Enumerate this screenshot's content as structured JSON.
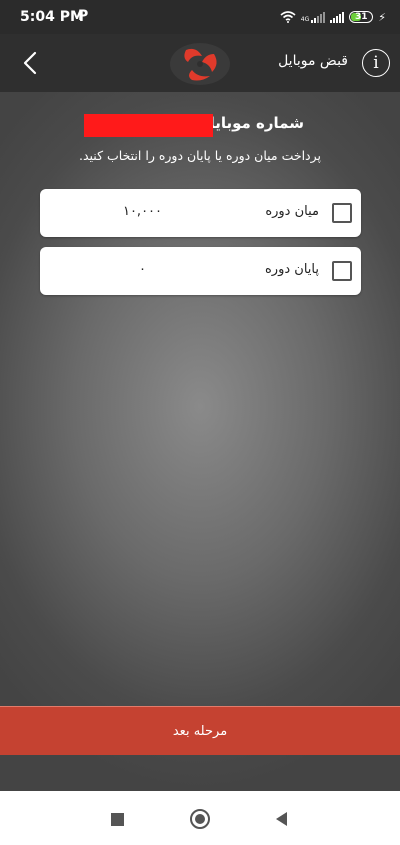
{
  "status_bar": {
    "time": "5:04 PM",
    "notification_glyph": "P",
    "network_label": "4G",
    "battery_level": "31",
    "icons": [
      "wifi-icon",
      "signal-icon",
      "signal-icon",
      "battery-icon",
      "charging-bolt-icon"
    ]
  },
  "header": {
    "title": "قبض موبایل",
    "info_glyph": "i",
    "back_icon": "chevron-left-icon",
    "logo_icon": "brand-logo-icon"
  },
  "form": {
    "mobile_label": "شماره موبایل:",
    "instruction": "پرداخت میان دوره یا پایان دوره را انتخاب کنید.",
    "options": [
      {
        "label": "میان دوره",
        "amount": "۱۰,۰۰۰",
        "checked": false
      },
      {
        "label": "پایان دوره",
        "amount": "۰",
        "checked": false
      }
    ]
  },
  "footer": {
    "next_label": "مرحله بعد"
  },
  "colors": {
    "header_bg": "#2f2f2f",
    "accent_red": "#c54231",
    "redaction": "#ff1a1a"
  },
  "nav_bar": {
    "icons": [
      "recents-square-icon",
      "home-circle-icon",
      "back-triangle-icon"
    ]
  }
}
